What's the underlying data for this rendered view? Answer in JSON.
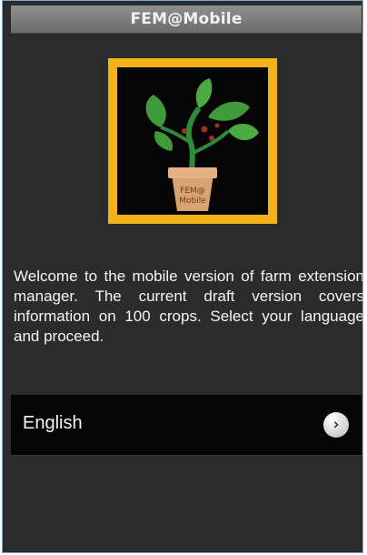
{
  "app": {
    "title": "FEM@Mobile"
  },
  "logo": {
    "pot_text": "FEM@ Mobile",
    "icon": "plant-in-pot-icon"
  },
  "main": {
    "welcome_text": "Welcome to the mobile version of farm extension manager. The current draft version covers information on 100 crops. Select your language and proceed."
  },
  "languages": [
    {
      "label": "English",
      "icon": "chevron-right-icon"
    }
  ],
  "colors": {
    "titlebar": "#7d7d7d",
    "logo_border": "#f2b21a",
    "background": "#2b2b2b",
    "list_row": "#060606"
  }
}
